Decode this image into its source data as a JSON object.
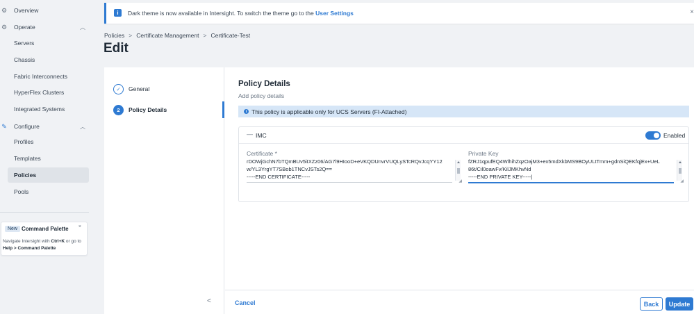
{
  "sidebar": {
    "items": [
      {
        "label": "Overview",
        "icon": "overview-icon"
      },
      {
        "label": "Operate",
        "icon": "operate-icon"
      },
      {
        "label": "Servers"
      },
      {
        "label": "Chassis"
      },
      {
        "label": "Fabric Interconnects"
      },
      {
        "label": "HyperFlex Clusters"
      },
      {
        "label": "Integrated Systems"
      },
      {
        "label": "Configure",
        "icon": "configure-icon"
      },
      {
        "label": "Profiles"
      },
      {
        "label": "Templates"
      },
      {
        "label": "Policies"
      },
      {
        "label": "Pools"
      }
    ],
    "command_palette": {
      "badge": "New",
      "title": "Command Palette",
      "close": "×",
      "text_prefix": "Navigate Intersight with ",
      "shortcut": "Ctrl+K",
      "text_mid": " or go to ",
      "path": "Help > Command Palette"
    }
  },
  "banner": {
    "text": "Dark theme is now available in Intersight. To switch the theme go to the ",
    "link": "User Settings",
    "close": "×"
  },
  "breadcrumb": {
    "items": [
      "Policies",
      "Certificate Management",
      "Certificate-Test"
    ],
    "separator": ">"
  },
  "page": {
    "title": "Edit"
  },
  "steps": [
    {
      "number": "✓",
      "label": "General"
    },
    {
      "number": "2",
      "label": "Policy Details"
    }
  ],
  "collapse_icon": "<",
  "policy": {
    "title": "Policy Details",
    "subtitle": "Add policy details",
    "info": "This policy is applicable only for UCS Servers (FI-Attached)",
    "imc": {
      "title": "IMC",
      "toggle_label": "Enabled",
      "certificate": {
        "label": "Certificate *",
        "lines": [
          "rDOWjGchN7bTQmBUv5iIXZz06/AG7l9HIooD+eVKQDUnvrVUQLySTcRQvJcqYY12",
          "w/YL3YrgYT7SBob1TNCvJSTs2Q==",
          "-----END CERTIFICATE-----"
        ]
      },
      "private_key": {
        "label": "Private Key",
        "lines": [
          "fZRJ1qpufEQ4WlhihZqzOajM3+ex5mdXkbMS9BOyULtTmm+gdnSiQEKfqjEx+UeL",
          "86t/Cil0oawFv/KilJMKhvNd",
          "-----END PRIVATE KEY-----|"
        ]
      }
    }
  },
  "footer": {
    "cancel": "Cancel",
    "back": "Back",
    "update": "Update"
  }
}
